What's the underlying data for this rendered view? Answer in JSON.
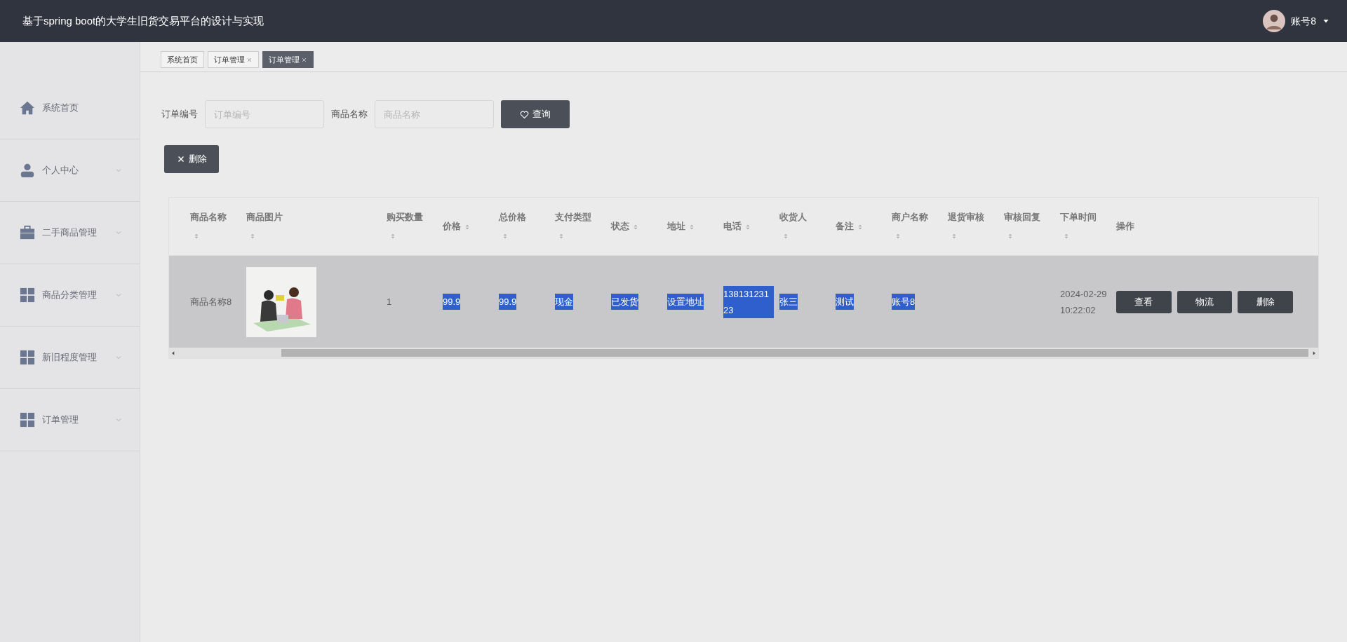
{
  "header": {
    "title": "基于spring boot的大学生旧货交易平台的设计与实现",
    "user": "账号8"
  },
  "sidebar": {
    "items": [
      {
        "label": "系统首页",
        "expandable": false
      },
      {
        "label": "个人中心",
        "expandable": true
      },
      {
        "label": "二手商品管理",
        "expandable": true
      },
      {
        "label": "商品分类管理",
        "expandable": true
      },
      {
        "label": "新旧程度管理",
        "expandable": true
      },
      {
        "label": "订单管理",
        "expandable": true
      }
    ]
  },
  "tabs": [
    {
      "label": "系统首页",
      "closable": false,
      "selected": false
    },
    {
      "label": "订单管理",
      "closable": true,
      "selected": false
    },
    {
      "label": "订单管理",
      "closable": true,
      "selected": true
    }
  ],
  "filters": [
    {
      "label": "订单编号",
      "placeholder": "订单编号"
    },
    {
      "label": "商品名称",
      "placeholder": "商品名称"
    }
  ],
  "search_button": "查询",
  "delete_button": "删除",
  "table": {
    "columns": [
      {
        "label": "商品名称",
        "sortable": true
      },
      {
        "label": "商品图片",
        "sortable": true
      },
      {
        "label": "购买数量",
        "sortable": true
      },
      {
        "label": "价格",
        "sortable": true
      },
      {
        "label": "总价格",
        "sortable": true
      },
      {
        "label": "支付类型",
        "sortable": true
      },
      {
        "label": "状态",
        "sortable": true
      },
      {
        "label": "地址",
        "sortable": true
      },
      {
        "label": "电话",
        "sortable": true
      },
      {
        "label": "收货人",
        "sortable": true
      },
      {
        "label": "备注",
        "sortable": true
      },
      {
        "label": "商户名称",
        "sortable": true
      },
      {
        "label": "退货审核",
        "sortable": true
      },
      {
        "label": "审核回复",
        "sortable": true
      },
      {
        "label": "下单时间",
        "sortable": true
      },
      {
        "label": "操作",
        "sortable": false
      }
    ],
    "rows": [
      {
        "hovered": true,
        "cells": [
          {
            "kind": "text",
            "text": "商品名称8",
            "selected": false
          },
          {
            "kind": "picture"
          },
          {
            "kind": "text",
            "text": "1",
            "selected": false
          },
          {
            "kind": "text",
            "text": "99.9",
            "selected": true
          },
          {
            "kind": "text",
            "text": "99.9",
            "selected": true
          },
          {
            "kind": "text",
            "text": "现金",
            "selected": true
          },
          {
            "kind": "text",
            "text": "已发货",
            "selected": true
          },
          {
            "kind": "text",
            "text": "设置地址",
            "selected": true
          },
          {
            "kind": "text",
            "text": "13813123123",
            "selected": true
          },
          {
            "kind": "text",
            "text": "张三",
            "selected": true
          },
          {
            "kind": "text",
            "text": "测试",
            "selected": true
          },
          {
            "kind": "text",
            "text": "账号8",
            "selected": true
          },
          {
            "kind": "empty"
          },
          {
            "kind": "empty"
          },
          {
            "kind": "text",
            "text": "2024-02-29 10:22:02",
            "selected": false
          },
          {
            "kind": "actions",
            "buttons": [
              "查看",
              "物流",
              "删除"
            ]
          }
        ]
      }
    ]
  }
}
